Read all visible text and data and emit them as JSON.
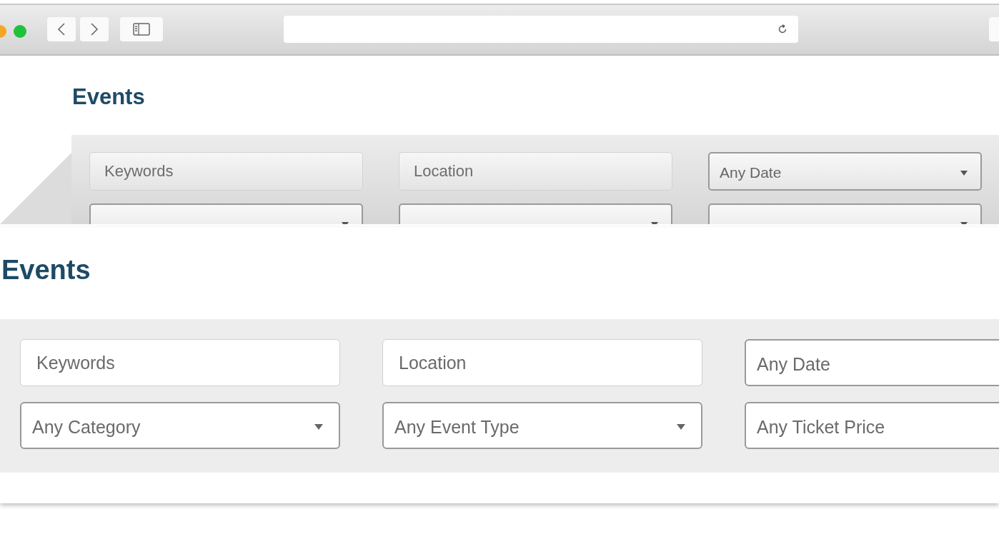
{
  "back_page": {
    "title": "Events",
    "fields": [
      {
        "kind": "text",
        "placeholder": "Keywords"
      },
      {
        "kind": "text",
        "placeholder": "Location"
      },
      {
        "kind": "select",
        "value": "Any Date",
        "caret": true
      },
      {
        "kind": "select",
        "caret": true
      },
      {
        "kind": "select",
        "caret": true
      },
      {
        "kind": "select",
        "caret": true
      }
    ]
  },
  "zoomed_page": {
    "title": "Events",
    "fields": [
      {
        "kind": "text",
        "placeholder": "Keywords"
      },
      {
        "kind": "text",
        "placeholder": "Location"
      },
      {
        "kind": "select",
        "value": "Any Date",
        "caret": false
      },
      {
        "kind": "select",
        "value": "Any Category",
        "caret": true
      },
      {
        "kind": "select",
        "value": "Any Event Type",
        "caret": true
      },
      {
        "kind": "select",
        "value": "Any Ticket Price",
        "caret": false
      }
    ]
  }
}
